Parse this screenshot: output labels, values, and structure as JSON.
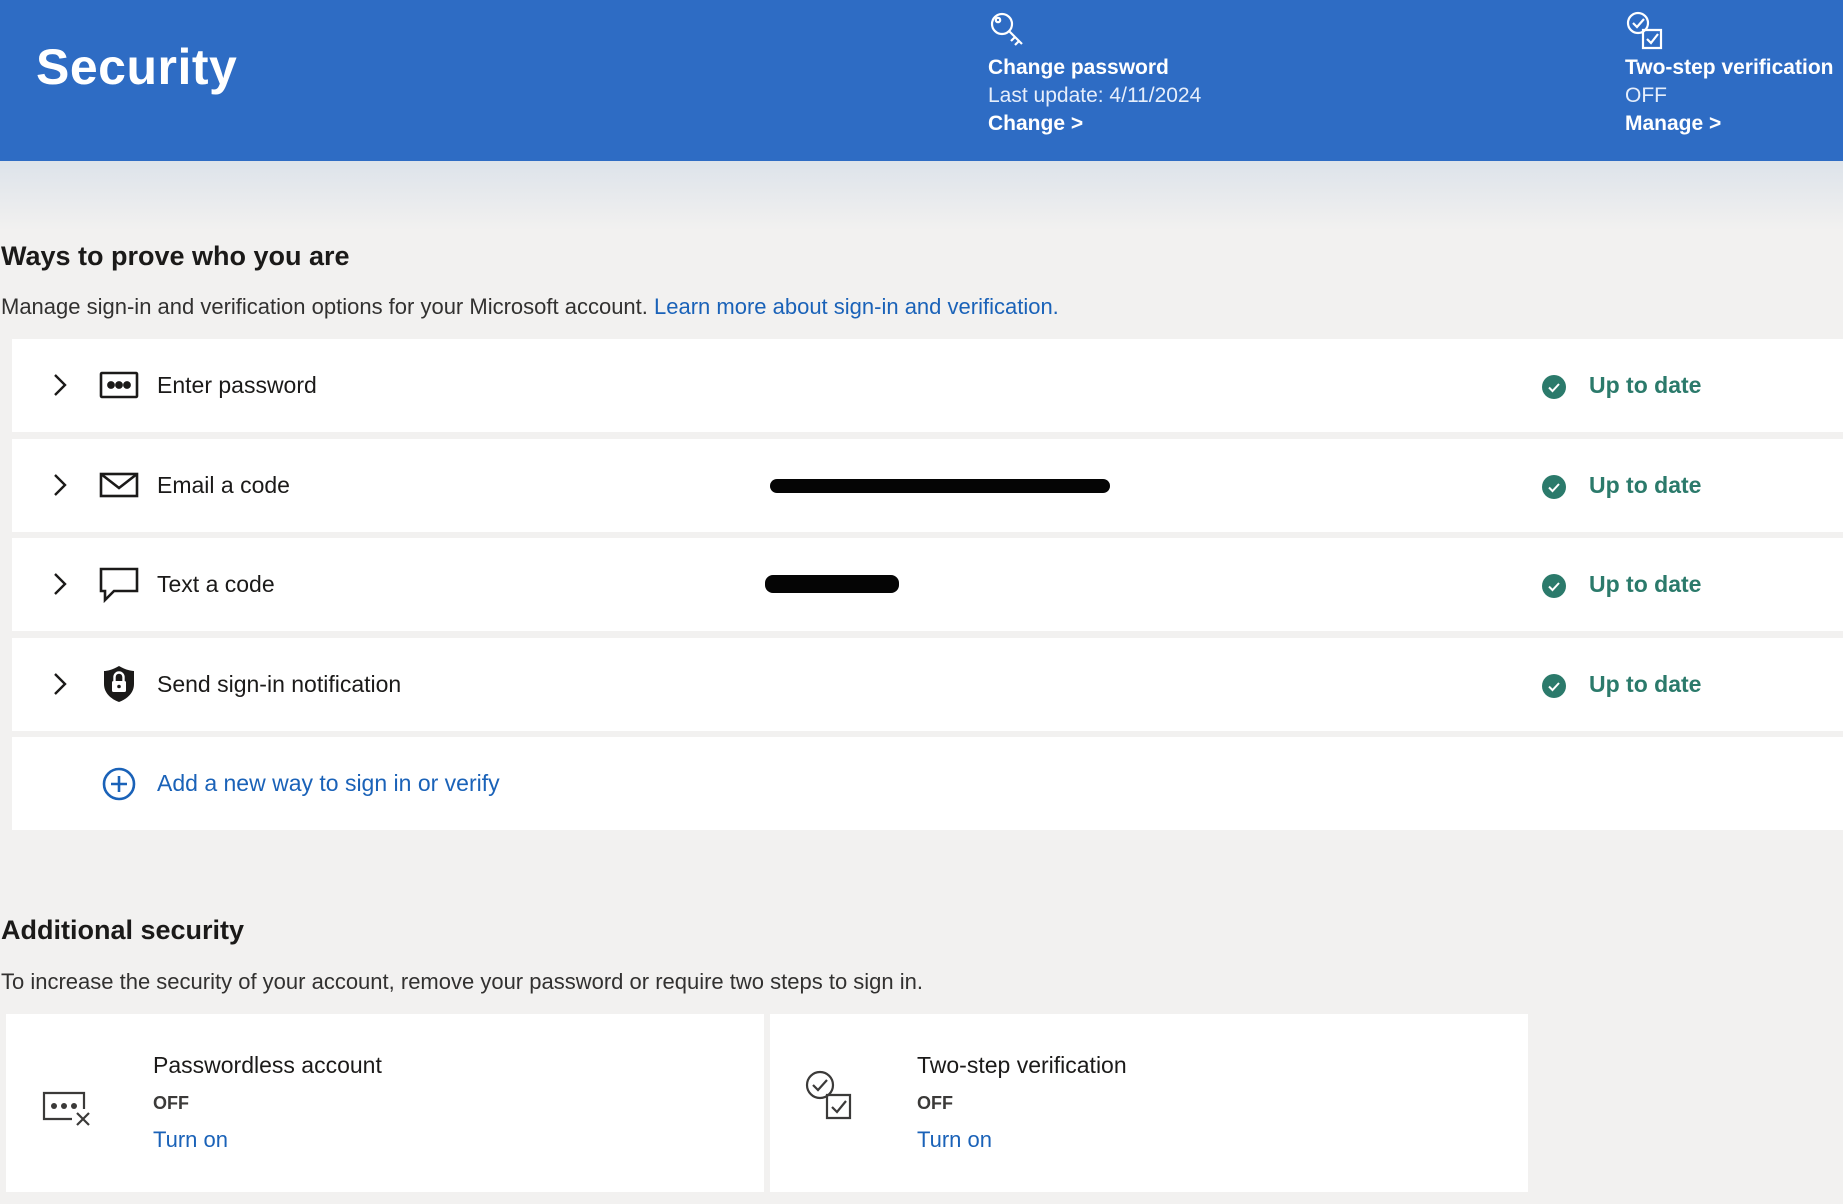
{
  "header": {
    "title": "Security",
    "change_password": {
      "icon": "key-icon",
      "title": "Change password",
      "subtitle": "Last update: 4/11/2024",
      "action": "Change >"
    },
    "two_step": {
      "icon": "check-squares-icon",
      "title": "Two-step verification",
      "status": "OFF",
      "action": "Manage >"
    }
  },
  "ways": {
    "heading": "Ways to prove who you are",
    "description": "Manage sign-in and verification options for your Microsoft account. ",
    "learn_more": "Learn more about sign-in and verification.",
    "methods": [
      {
        "label": "Enter password",
        "icon": "password-dots-icon",
        "status": "Up to date"
      },
      {
        "label": "Email a code",
        "icon": "envelope-icon",
        "status": "Up to date"
      },
      {
        "label": "Text a code",
        "icon": "chat-bubble-icon",
        "status": "Up to date"
      },
      {
        "label": "Send sign-in notification",
        "icon": "shield-lock-icon",
        "status": "Up to date"
      }
    ],
    "add_label": "Add a new way to sign in or verify"
  },
  "additional": {
    "heading": "Additional security",
    "description": "To increase the security of your account, remove your password or require two steps to sign in.",
    "cards": [
      {
        "title": "Passwordless account",
        "status": "OFF",
        "action": "Turn on",
        "icon": "password-removed-icon"
      },
      {
        "title": "Two-step verification",
        "status": "OFF",
        "action": "Turn on",
        "icon": "check-squares-icon"
      }
    ]
  },
  "colors": {
    "header_bg": "#2e6cc4",
    "link": "#1a62b8",
    "status_green": "#2b7a6b",
    "page_bg": "#f2f1f0"
  }
}
